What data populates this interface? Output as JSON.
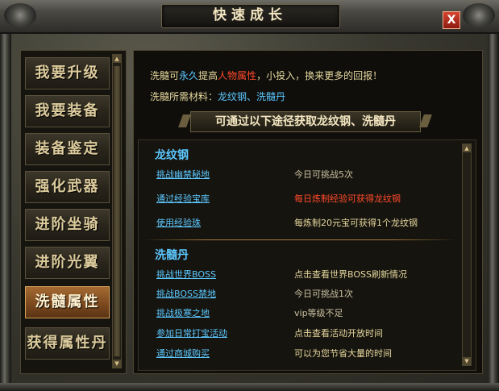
{
  "window": {
    "title": "快速成长",
    "close_label": "X"
  },
  "nav": {
    "items": [
      {
        "label": "我要升级"
      },
      {
        "label": "我要装备"
      },
      {
        "label": "装备鉴定"
      },
      {
        "label": "强化武器"
      },
      {
        "label": "进阶坐骑"
      },
      {
        "label": "进阶光翼"
      },
      {
        "label": "洗髓属性",
        "active": true
      },
      {
        "label": "获得属性丹"
      }
    ]
  },
  "content": {
    "intro": {
      "p1": "洗髓可",
      "p2": "永久",
      "p3": "提高",
      "p4": "人物属性",
      "p5": "，小投入，换来更多的回报！"
    },
    "materials": {
      "label": "洗髓所需材料：",
      "value": "龙纹钢、洗髓丹"
    },
    "banner": "可通过以下途径获取龙纹钢、洗髓丹",
    "sections": [
      {
        "title": "龙纹钢",
        "rows": [
          {
            "link": "挑战幽禁秘地",
            "desc": "今日可挑战5次"
          },
          {
            "link": "通过经验宝库",
            "desc": "每日炼制经验可获得龙纹钢"
          },
          {
            "link": "使用经验珠",
            "desc": "每炼制20元宝可获得1个龙纹钢"
          }
        ]
      },
      {
        "title": "洗髓丹",
        "rows": [
          {
            "link": "挑战世界BOSS",
            "desc": "点击查看世界BOSS刷新情况"
          },
          {
            "link": "挑战BOSS禁地",
            "desc": "今日可挑战1次"
          },
          {
            "link": "挑战极寒之地",
            "desc": "vip等级不足"
          },
          {
            "link": "参加日常打宝活动",
            "desc": "点击查看活动开放时间"
          },
          {
            "link": "通过商城购买",
            "desc": "可以为您节省大量的时间"
          }
        ]
      }
    ]
  },
  "colors": {
    "link": "#5cc8ff",
    "highlight_red": "#ff4a2a",
    "text": "#e6d89e",
    "active_tab": "#a56a32"
  },
  "icons": {
    "close": "close-icon",
    "scroll_up": "chevron-up-icon",
    "scroll_down": "chevron-down-icon"
  }
}
